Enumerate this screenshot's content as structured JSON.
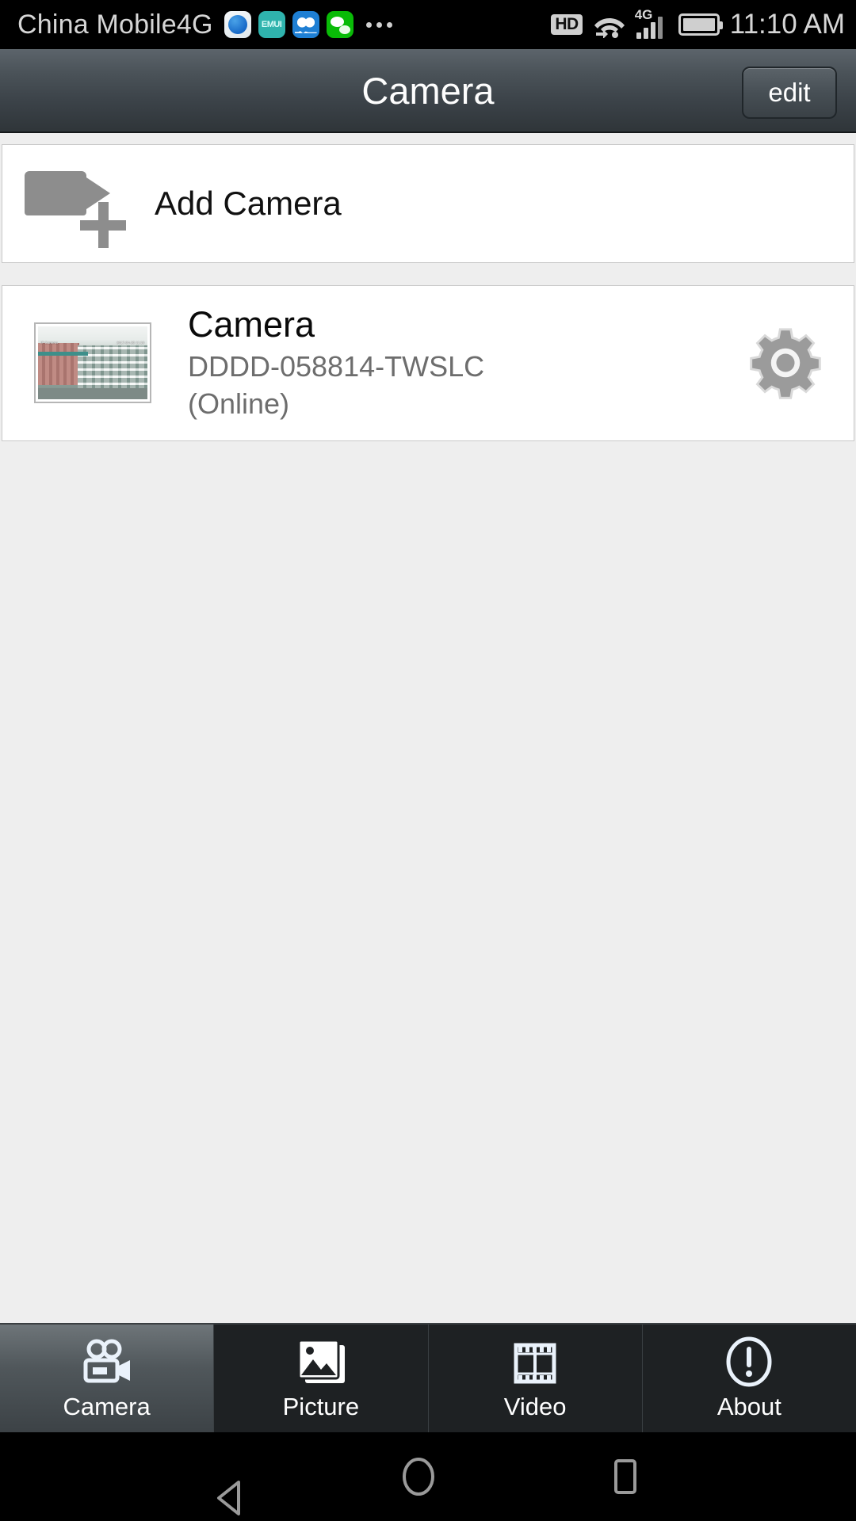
{
  "status_bar": {
    "carrier": "China Mobile4G",
    "app_icons": [
      "browser-icon",
      "emui-icon",
      "health-icon",
      "wechat-icon"
    ],
    "emui_label": "EMUI",
    "overflow": "more-dots-icon",
    "hd_badge": "HD",
    "wifi": "wifi-icon",
    "network_type": "4G",
    "signal": "signal-bars-icon",
    "battery": "battery-full-icon",
    "time": "11:10 AM"
  },
  "title_bar": {
    "title": "Camera",
    "edit_label": "edit"
  },
  "add_camera": {
    "icon": "video-camera-plus-icon",
    "label": "Add Camera"
  },
  "camera_list": [
    {
      "thumbnail_label": "IP Camera",
      "thumbnail_timestamp": "2017-04-20 11:10",
      "name": "Camera",
      "uid": "DDDD-058814-TWSLC",
      "status": "(Online)",
      "settings_icon": "gear-icon"
    }
  ],
  "tab_bar": {
    "active_index": 0,
    "tabs": [
      {
        "label": "Camera",
        "icon": "movie-camera-icon"
      },
      {
        "label": "Picture",
        "icon": "photo-stack-icon"
      },
      {
        "label": "Video",
        "icon": "film-strip-icon"
      },
      {
        "label": "About",
        "icon": "exclamation-circle-icon"
      }
    ]
  },
  "nav_bar": {
    "back": "back-triangle-icon",
    "home": "home-circle-icon",
    "recents": "recents-square-icon"
  },
  "colors": {
    "accent": "#4b5359",
    "page_bg": "#eeeeee",
    "card_bg": "#ffffff",
    "muted_text": "#6d6d6d",
    "tabbar_bg": "#1e2123"
  }
}
